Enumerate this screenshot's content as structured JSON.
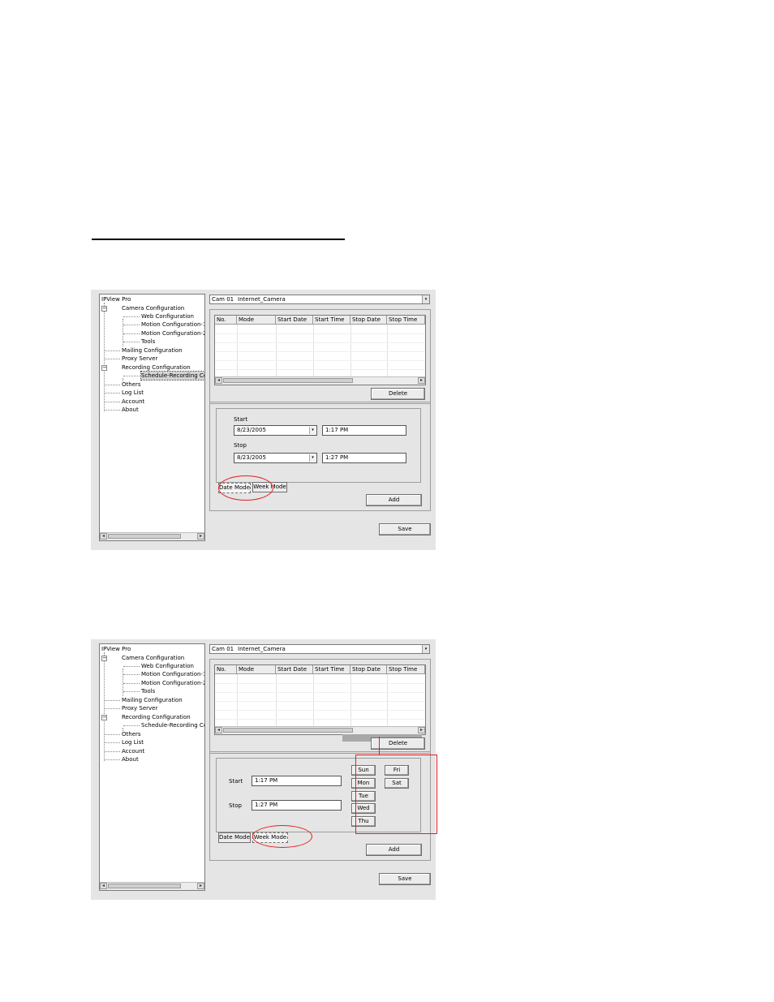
{
  "tree": {
    "root": "IPView Pro",
    "camera_config": "Camera Configuration",
    "web_config": "Web Configuration",
    "motion_config_1": "Motion Configuration-1",
    "motion_config_2": "Motion Configuration-2",
    "tools": "Tools",
    "mailing_config": "Mailing Configuration",
    "proxy_server": "Proxy Server",
    "recording_config": "Recording Configuration",
    "schedule_recording": "Schedule-Recording Con",
    "others": "Others",
    "log_list": "Log List",
    "account": "Account",
    "about": "About"
  },
  "camera_select": {
    "cam": "Cam 01",
    "name": "Internet_Camera"
  },
  "table": {
    "columns": [
      "No.",
      "Mode",
      "Start Date",
      "Start Time",
      "Stop Date",
      "Stop Time"
    ]
  },
  "buttons": {
    "delete": "Delete",
    "add": "Add",
    "save": "Save"
  },
  "date_mode": {
    "start_label": "Start",
    "stop_label": "Stop",
    "start_date": "8/23/2005",
    "start_time": "1:17 PM",
    "stop_date": "8/23/2005",
    "stop_time": "1:27 PM"
  },
  "week_mode": {
    "start_label": "Start",
    "stop_label": "Stop",
    "start_time": "1:17 PM",
    "stop_time": "1:27 PM",
    "days": [
      "Sun",
      "Mon",
      "Tue",
      "Wed",
      "Thu",
      "Fri",
      "Sat"
    ]
  },
  "tabs": {
    "date_mode": "Date Mode",
    "week_mode": "Week Mode"
  }
}
